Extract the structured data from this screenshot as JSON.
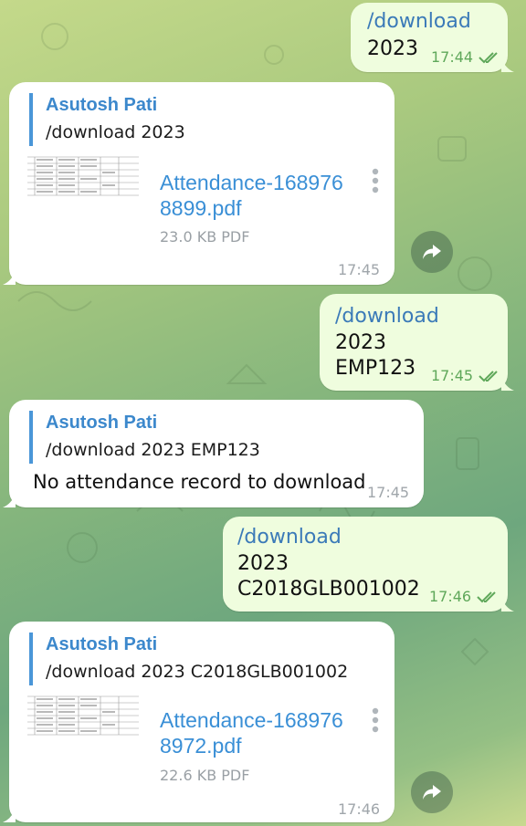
{
  "messages": [
    {
      "cmd": "/download",
      "text": "2023",
      "time": "17:44"
    },
    {
      "reply_name": "Asutosh Pati",
      "reply_text": "/download 2023",
      "file_name_1": "Attendance-168976",
      "file_name_2": "8899.pdf",
      "file_size": "23.0 KB PDF",
      "time": "17:45"
    },
    {
      "cmd": "/download",
      "text": "2023\nEMP123",
      "time": "17:45"
    },
    {
      "reply_name": "Asutosh Pati",
      "reply_text": "/download 2023 EMP123",
      "body": "No attendance record to download",
      "time": "17:45"
    },
    {
      "cmd": "/download",
      "text": "2023\nC2018GLB001002",
      "time": "17:46"
    },
    {
      "reply_name": "Asutosh Pati",
      "reply_text": "/download 2023 C2018GLB001002",
      "file_name_1": "Attendance-168976",
      "file_name_2": "8972.pdf",
      "file_size": "22.6 KB PDF",
      "time": "17:46"
    }
  ],
  "colors": {
    "outgoing_bubble": "#effdde",
    "incoming_bubble": "#ffffff",
    "accent": "#3b7ab8",
    "check": "#5fa85a"
  },
  "icons": {
    "read_receipt": "double-check-icon",
    "menu": "vertical-dots-icon",
    "share": "share-arrow-icon"
  }
}
